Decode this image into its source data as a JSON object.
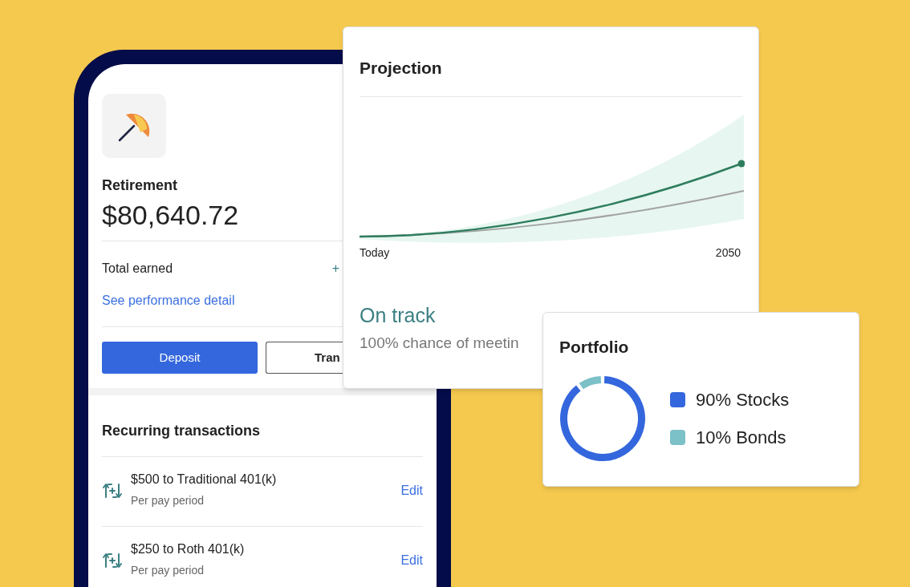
{
  "account": {
    "title": "Retirement",
    "balance": "$80,640.72",
    "total_label": "Total earned",
    "total_value": "+",
    "link": "See performance detail",
    "buttons": [
      {
        "label": "Deposit",
        "kind": "primary"
      },
      {
        "label": "Tran",
        "kind": "secondary"
      }
    ]
  },
  "recurring": {
    "title": "Recurring transactions",
    "items": [
      {
        "title": "$500 to Traditional 401(k)",
        "subtitle": "Per pay period",
        "action": "Edit"
      },
      {
        "title": "$250 to Roth 401(k)",
        "subtitle": "Per pay period",
        "action": "Edit"
      }
    ]
  },
  "projection": {
    "title": "Projection",
    "x_start": "Today",
    "x_end": "2050",
    "status": "On track",
    "detail": "100% chance of meetin"
  },
  "portfolio": {
    "title": "Portfolio",
    "legend": [
      {
        "label": "90% Stocks",
        "color": "#3467dd"
      },
      {
        "label": "10% Bonds",
        "color": "#7cc0c8"
      }
    ],
    "chart_data": {
      "type": "donut",
      "values": [
        90,
        10
      ]
    }
  }
}
